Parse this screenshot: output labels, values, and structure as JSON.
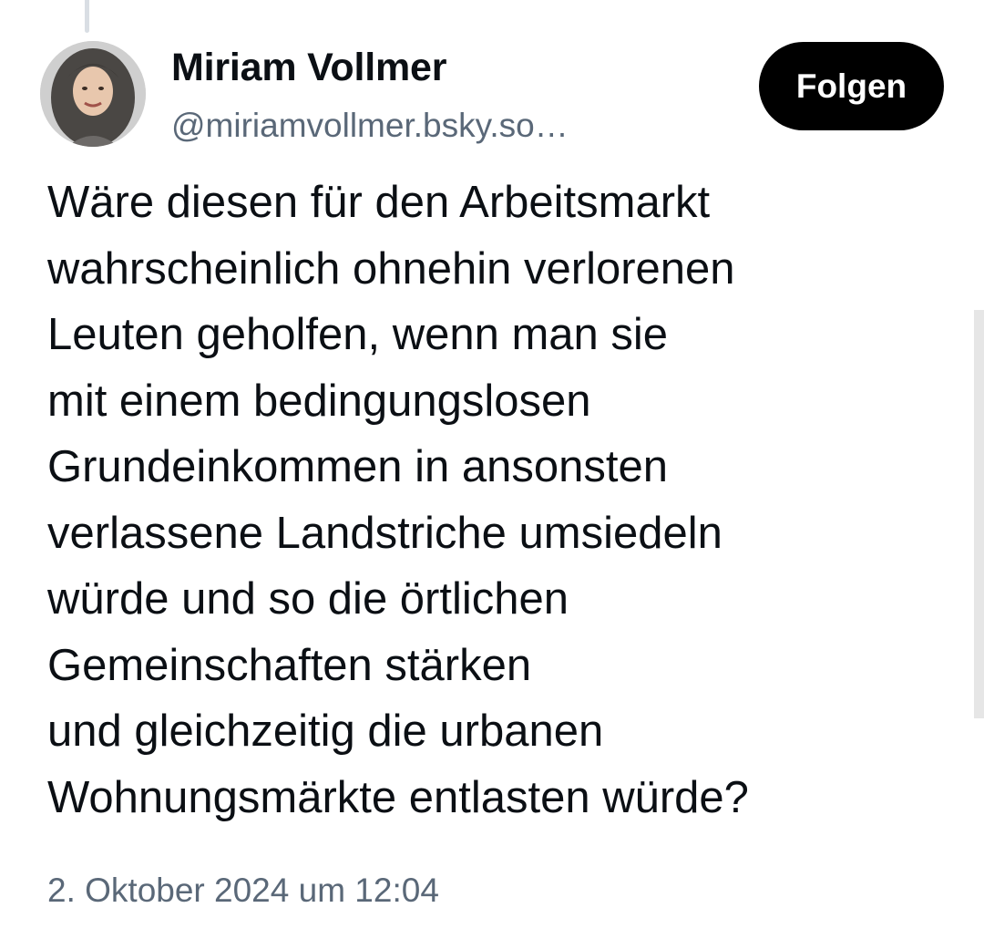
{
  "author": {
    "display_name": "Miriam Vollmer",
    "handle": "@miriamvollmer.bsky.so…",
    "avatar_icon": "profile-photo"
  },
  "actions": {
    "follow_label": "Folgen"
  },
  "post": {
    "lines": [
      "Wäre diesen für den Arbeitsmarkt",
      "wahrscheinlich ohnehin verlorenen",
      "Leuten geholfen, wenn man sie",
      "mit einem bedingungslosen",
      "Grundeinkommen in ansonsten",
      "verlassene Landstriche umsiedeln",
      "würde und so die örtlichen",
      "Gemeinschaften stärken",
      "und gleichzeitig die urbanen",
      "Wohnungsmärkte entlasten würde?"
    ],
    "timestamp": "2. Oktober 2024 um 12:04"
  },
  "colors": {
    "text": "#0b0f14",
    "muted": "#5a6878",
    "button_bg": "#000000",
    "button_text": "#ffffff"
  }
}
